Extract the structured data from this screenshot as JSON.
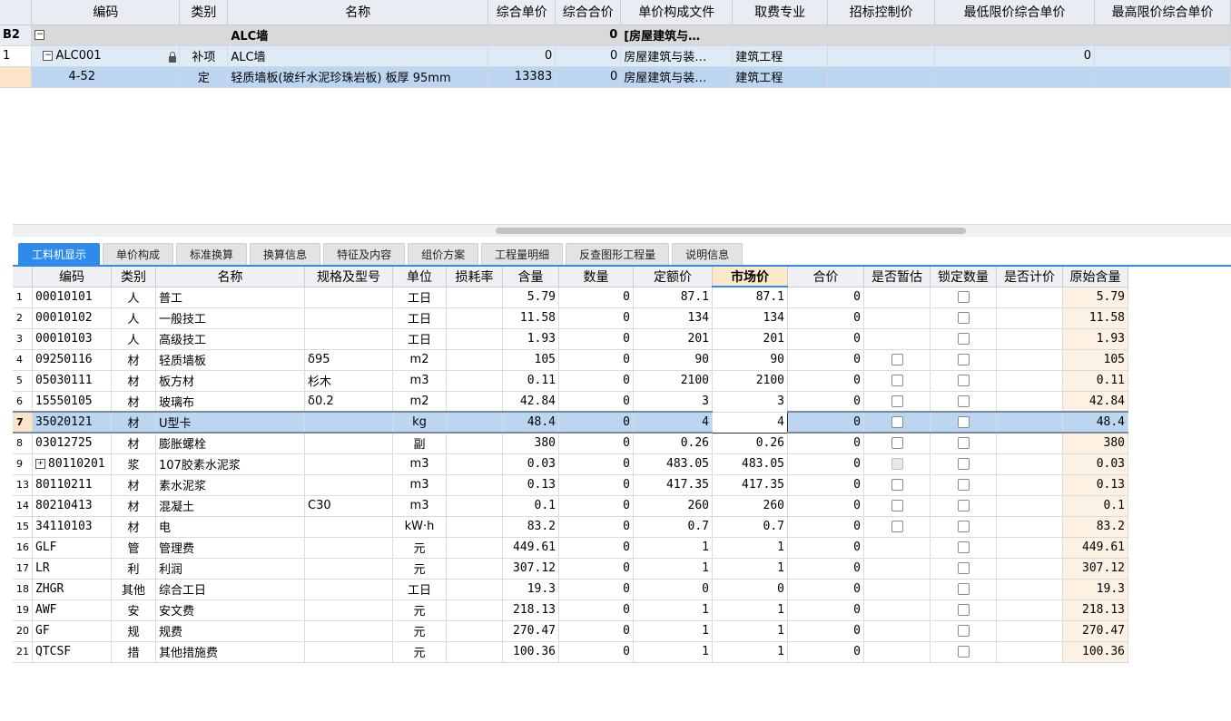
{
  "top_grid": {
    "headers": [
      "编码",
      "类别",
      "名称",
      "综合单价",
      "综合合价",
      "单价构成文件",
      "取费专业",
      "招标控制价",
      "最低限价综合单价",
      "最高限价综合单价"
    ],
    "group_row": {
      "rownum": "B2",
      "expand": "−",
      "name": "ALC墙",
      "total": "0",
      "file": "[房屋建筑与…"
    },
    "alc_row": {
      "rownum": "1",
      "expand": "−",
      "code": "ALC001",
      "type": "补项",
      "name": "ALC墙",
      "unit_price": "0",
      "total": "0",
      "file": "房屋建筑与装…",
      "fee": "建筑工程",
      "min_price": "0"
    },
    "sub_row": {
      "code": "4-52",
      "type": "定",
      "name": "轻质墙板(玻纤水泥珍珠岩板) 板厚 95mm",
      "unit_price": "13383",
      "total": "0",
      "file": "房屋建筑与装…",
      "fee": "建筑工程"
    }
  },
  "tabs": [
    "工料机显示",
    "单价构成",
    "标准换算",
    "换算信息",
    "特征及内容",
    "组价方案",
    "工程量明细",
    "反查图形工程量",
    "说明信息"
  ],
  "bottom_grid": {
    "headers": [
      "编码",
      "类别",
      "名称",
      "规格及型号",
      "单位",
      "损耗率",
      "含量",
      "数量",
      "定额价",
      "市场价",
      "合价",
      "是否暂估",
      "锁定数量",
      "是否计价",
      "原始含量"
    ],
    "rows": [
      {
        "rn": "1",
        "code": "00010101",
        "cat": "人",
        "name": "普工",
        "spec": "",
        "unit": "工日",
        "content": "5.79",
        "qty": "0",
        "quota": "87.1",
        "market": "87.1",
        "total": "0",
        "est": "none",
        "lock": "box",
        "orig": "5.79"
      },
      {
        "rn": "2",
        "code": "00010102",
        "cat": "人",
        "name": "一般技工",
        "spec": "",
        "unit": "工日",
        "content": "11.58",
        "qty": "0",
        "quota": "134",
        "market": "134",
        "total": "0",
        "est": "none",
        "lock": "box",
        "orig": "11.58"
      },
      {
        "rn": "3",
        "code": "00010103",
        "cat": "人",
        "name": "高级技工",
        "spec": "",
        "unit": "工日",
        "content": "1.93",
        "qty": "0",
        "quota": "201",
        "market": "201",
        "total": "0",
        "est": "none",
        "lock": "box",
        "orig": "1.93"
      },
      {
        "rn": "4",
        "code": "09250116",
        "cat": "材",
        "name": "轻质墙板",
        "spec": "δ95",
        "unit": "m2",
        "content": "105",
        "qty": "0",
        "quota": "90",
        "market": "90",
        "total": "0",
        "est": "box",
        "lock": "box",
        "orig": "105"
      },
      {
        "rn": "5",
        "code": "05030111",
        "cat": "材",
        "name": "板方材",
        "spec": "杉木",
        "unit": "m3",
        "content": "0.11",
        "qty": "0",
        "quota": "2100",
        "market": "2100",
        "total": "0",
        "est": "box",
        "lock": "box",
        "orig": "0.11"
      },
      {
        "rn": "6",
        "code": "15550105",
        "cat": "材",
        "name": "玻璃布",
        "spec": "δ0.2",
        "unit": "m2",
        "content": "42.84",
        "qty": "0",
        "quota": "3",
        "market": "3",
        "total": "0",
        "est": "box",
        "lock": "box",
        "orig": "42.84"
      },
      {
        "rn": "7",
        "code": "35020121",
        "cat": "材",
        "name": "U型卡",
        "spec": "",
        "unit": "kg",
        "content": "48.4",
        "qty": "0",
        "quota": "4",
        "market": "4",
        "total": "0",
        "est": "box",
        "lock": "box",
        "orig": "48.4",
        "selected": true
      },
      {
        "rn": "8",
        "code": "03012725",
        "cat": "材",
        "name": "膨胀螺栓",
        "spec": "",
        "unit": "副",
        "content": "380",
        "qty": "0",
        "quota": "0.26",
        "market": "0.26",
        "total": "0",
        "est": "box",
        "lock": "box",
        "orig": "380"
      },
      {
        "rn": "9",
        "code": "80110201",
        "cat": "浆",
        "name": "107胶素水泥浆",
        "spec": "",
        "unit": "m3",
        "content": "0.03",
        "qty": "0",
        "quota": "483.05",
        "market": "483.05",
        "total": "0",
        "est": "dis",
        "lock": "box",
        "orig": "0.03",
        "expand": "+"
      },
      {
        "rn": "13",
        "code": "80110211",
        "cat": "材",
        "name": "素水泥浆",
        "spec": "",
        "unit": "m3",
        "content": "0.13",
        "qty": "0",
        "quota": "417.35",
        "market": "417.35",
        "total": "0",
        "est": "box",
        "lock": "box",
        "orig": "0.13"
      },
      {
        "rn": "14",
        "code": "80210413",
        "cat": "材",
        "name": "混凝土",
        "spec": "C30",
        "unit": "m3",
        "content": "0.1",
        "qty": "0",
        "quota": "260",
        "market": "260",
        "total": "0",
        "est": "box",
        "lock": "box",
        "orig": "0.1"
      },
      {
        "rn": "15",
        "code": "34110103",
        "cat": "材",
        "name": "电",
        "spec": "",
        "unit": "kW·h",
        "content": "83.2",
        "qty": "0",
        "quota": "0.7",
        "market": "0.7",
        "total": "0",
        "est": "box",
        "lock": "box",
        "orig": "83.2"
      },
      {
        "rn": "16",
        "code": "GLF",
        "cat": "管",
        "name": "管理费",
        "spec": "",
        "unit": "元",
        "content": "449.61",
        "qty": "0",
        "quota": "1",
        "market": "1",
        "total": "0",
        "est": "none",
        "lock": "box",
        "orig": "449.61"
      },
      {
        "rn": "17",
        "code": "LR",
        "cat": "利",
        "name": "利润",
        "spec": "",
        "unit": "元",
        "content": "307.12",
        "qty": "0",
        "quota": "1",
        "market": "1",
        "total": "0",
        "est": "none",
        "lock": "box",
        "orig": "307.12"
      },
      {
        "rn": "18",
        "code": "ZHGR",
        "cat": "其他",
        "name": "综合工日",
        "spec": "",
        "unit": "工日",
        "content": "19.3",
        "qty": "0",
        "quota": "0",
        "market": "0",
        "total": "0",
        "est": "none",
        "lock": "box",
        "orig": "19.3"
      },
      {
        "rn": "19",
        "code": "AWF",
        "cat": "安",
        "name": "安文费",
        "spec": "",
        "unit": "元",
        "content": "218.13",
        "qty": "0",
        "quota": "1",
        "market": "1",
        "total": "0",
        "est": "none",
        "lock": "box",
        "orig": "218.13"
      },
      {
        "rn": "20",
        "code": "GF",
        "cat": "规",
        "name": "规费",
        "spec": "",
        "unit": "元",
        "content": "270.47",
        "qty": "0",
        "quota": "1",
        "market": "1",
        "total": "0",
        "est": "none",
        "lock": "box",
        "orig": "270.47"
      },
      {
        "rn": "21",
        "code": "QTCSF",
        "cat": "措",
        "name": "其他措施费",
        "spec": "",
        "unit": "元",
        "content": "100.36",
        "qty": "0",
        "quota": "1",
        "market": "1",
        "total": "0",
        "est": "none",
        "lock": "box",
        "orig": "100.36"
      }
    ]
  }
}
